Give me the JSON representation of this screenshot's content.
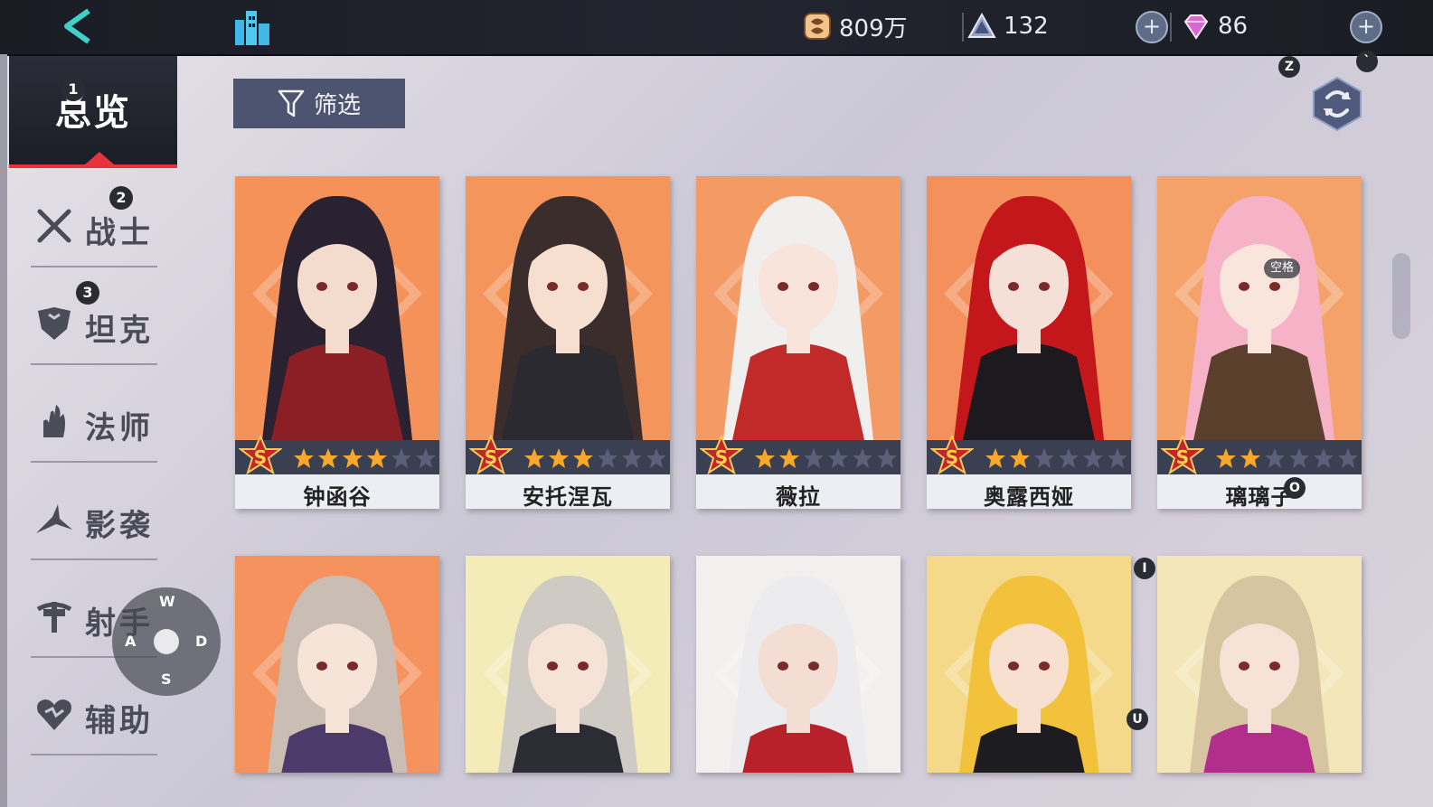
{
  "topbar": {
    "gold": "809万",
    "stamina": "132",
    "gems": "86",
    "plus_label": "+"
  },
  "sidebar": {
    "overview_label": "总览",
    "categories": [
      {
        "label": "战士",
        "icon": "crossed-swords-icon"
      },
      {
        "label": "坦克",
        "icon": "armor-icon"
      },
      {
        "label": "法师",
        "icon": "flame-hand-icon"
      },
      {
        "label": "影袭",
        "icon": "shadow-slash-icon"
      },
      {
        "label": "射手",
        "icon": "crossbow-icon"
      },
      {
        "label": "辅助",
        "icon": "heart-icon"
      }
    ],
    "badges": [
      "1",
      "2",
      "3"
    ]
  },
  "filter": {
    "label": "筛选"
  },
  "characters": [
    {
      "name": "钟函谷",
      "rank": "S",
      "stars": 4,
      "bg": "#f4925a",
      "hair": "#2a2230",
      "skin": "#f3dccd",
      "cloth": "#8c1f25"
    },
    {
      "name": "安托涅瓦",
      "rank": "S",
      "stars": 3,
      "bg": "#f4955c",
      "hair": "#3a2d2c",
      "skin": "#f6dfcf",
      "cloth": "#2a2a30"
    },
    {
      "name": "薇拉",
      "rank": "S",
      "stars": 2,
      "bg": "#f49a64",
      "hair": "#f1eeee",
      "skin": "#f8e4da",
      "cloth": "#c22a2a"
    },
    {
      "name": "奥露西娅",
      "rank": "S",
      "stars": 2,
      "bg": "#f3905c",
      "hair": "#c4171c",
      "skin": "#f5e0d8",
      "cloth": "#1c1a1e"
    },
    {
      "name": "璃璃子",
      "rank": "S",
      "stars": 2,
      "bg": "#f5a26a",
      "hair": "#f6b2c6",
      "skin": "#f9e5dc",
      "cloth": "#5a3f2c"
    },
    {
      "name": "",
      "rank": "",
      "stars": 0,
      "bg": "#f5925e",
      "hair": "#c9bdb4",
      "skin": "#f7e4d8",
      "cloth": "#4b3a6a"
    },
    {
      "name": "",
      "rank": "",
      "stars": 0,
      "bg": "#f3ecb8",
      "hair": "#cfcac4",
      "skin": "#f5e3d8",
      "cloth": "#2c2c34"
    },
    {
      "name": "",
      "rank": "",
      "stars": 0,
      "bg": "#f2f0ef",
      "hair": "#ecebee",
      "skin": "#f4ded4",
      "cloth": "#b8202a"
    },
    {
      "name": "",
      "rank": "",
      "stars": 0,
      "bg": "#f4d98a",
      "hair": "#f2c23c",
      "skin": "#f7e0cf",
      "cloth": "#1d1c20"
    },
    {
      "name": "",
      "rank": "",
      "stars": 0,
      "bg": "#f3e6b8",
      "hair": "#d7c4a0",
      "skin": "#f6e2d6",
      "cloth": "#b22d8c"
    }
  ],
  "dpad": {
    "up": "W",
    "left": "A",
    "right": "D",
    "down": "S"
  },
  "key_hints": {
    "refresh": "Z",
    "corner": "`",
    "row2_right": "I",
    "row2_right_lower": "U",
    "card5": "O"
  },
  "space_tag": "空格",
  "colors": {
    "accent_red": "#e5343c",
    "filter_bg": "#4d5470",
    "card_orange": "#f4925a"
  }
}
